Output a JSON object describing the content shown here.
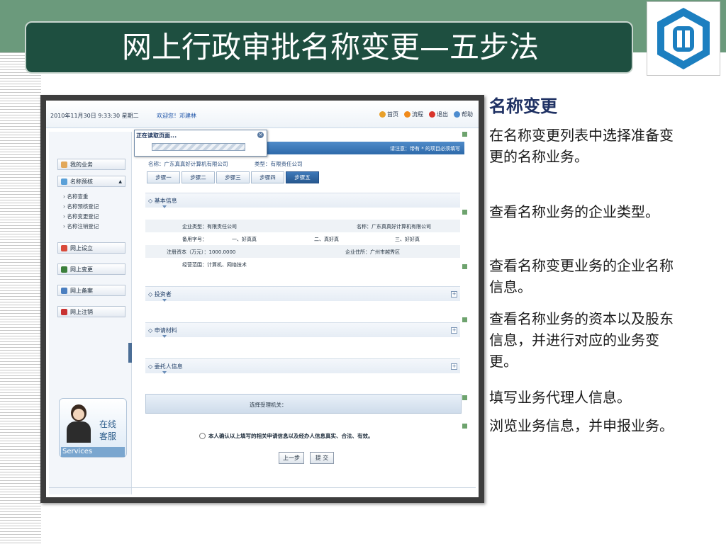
{
  "slide": {
    "title": "网上行政审批名称变更—五步法",
    "accent_color": "#1e4f40",
    "band_color": "#6b9a7c",
    "logo_icon": "company-logo-icon",
    "heading": "名称变更",
    "paragraphs": [
      "在名称变更列表中选择准备变更的名称业务。",
      "查看名称业务的企业类型。",
      "查看名称变更业务的企业名称信息。",
      "查看名称业务的资本以及股东信息，并进行对应的业务变更。",
      "填写业务代理人信息。",
      "浏览业务信息，并申报业务。"
    ]
  },
  "app": {
    "date": "2010年11月30日 9:33:30 星期二",
    "welcome": "欢迎您！邓建林",
    "top_links": [
      "首页",
      "流程",
      "退出",
      "帮助"
    ],
    "loading_dialog": {
      "title": "正在读取页面..."
    },
    "notice": "请注意：带有 * 的项目必须填写",
    "sidebar": {
      "items": [
        "我的业务",
        "名称预核",
        "网上设立",
        "网上变更",
        "网上备案",
        "网上注销"
      ],
      "subitems": [
        "名称查重",
        "名称预核登记",
        "名称变更登记",
        "名称注销登记"
      ],
      "service_text": [
        "在线",
        "客服"
      ],
      "service_en": "Services"
    },
    "company_line": "名称：广东真真好计算机有限公司",
    "type_line": "类型：有限责任公司",
    "tabs": [
      "步骤一",
      "步骤二",
      "步骤三",
      "步骤四",
      "步骤五"
    ],
    "active_tab": "步骤五",
    "sections": [
      "◇ 基本信息",
      "◇ 投资者",
      "◇ 申请材料",
      "◇ 委托人信息"
    ],
    "basic_info": {
      "company_type": "企业类型：有限责任公司",
      "name": "名称：广东真真好计算机有限公司",
      "alt_names_label": "备用字号：",
      "alt_name_1": "一、好真真",
      "alt_name_2": "二、真好真",
      "alt_name_3": "三、好好真",
      "capital": "注册资本（万元）：1000.0000",
      "address": "企业住所：广州市越秀区",
      "scope": "经营范围：计算机、网络技术"
    },
    "accept_label": "选择受理机关：",
    "confirm_text": "本人确认以上填写的相关申请信息以及经办人信息真实、合法、有效。",
    "buttons": {
      "prev": "上一步",
      "submit": "提 交"
    }
  }
}
